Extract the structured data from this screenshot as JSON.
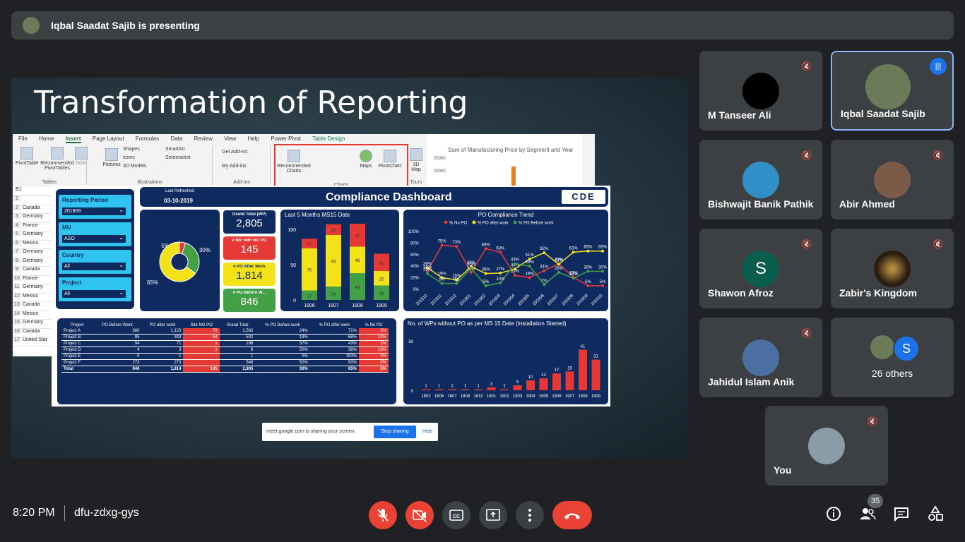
{
  "presenting": "Iqbal Saadat Sajib is presenting",
  "slide": {
    "title": "Transformation of Reporting",
    "ribbon_tabs": [
      "File",
      "Home",
      "Insert",
      "Page Layout",
      "Formulas",
      "Data",
      "Review",
      "View",
      "Help",
      "Power Pivot",
      "Table Design"
    ],
    "ribbon_groups": {
      "tables": "Tables",
      "illustrations": "Illustrations",
      "addins": "Add-ins",
      "charts": "Charts",
      "tours": "Tours"
    },
    "ribbon_tools": {
      "pivot_table": "PivotTable",
      "rec_pivot": "Recommended PivotTables",
      "table": "Table",
      "pictures": "Pictures",
      "shapes": "Shapes",
      "icons": "Icons",
      "models_3d": "3D Models",
      "smartart": "SmartArt",
      "screenshot": "Screenshot",
      "get_addins": "Get Add-ins",
      "my_addins": "My Add-ins",
      "rec_charts": "Recommended Charts",
      "maps": "Maps",
      "pivot_chart": "PivotChart",
      "map_3d": "3D Map"
    },
    "chart_thumb": {
      "title": "Sum of Manufacturing Price by Segment and Year",
      "t1": "25000",
      "t2": "20000"
    },
    "sheet": {
      "cell_ref": "B1",
      "rows": [
        {
          "n": "1",
          "v": ""
        },
        {
          "n": "2",
          "v": "Canada"
        },
        {
          "n": "3",
          "v": "Germany"
        },
        {
          "n": "4",
          "v": "France"
        },
        {
          "n": "5",
          "v": "Germany"
        },
        {
          "n": "6",
          "v": "Mexico"
        },
        {
          "n": "7",
          "v": "Germany"
        },
        {
          "n": "8",
          "v": "Germany"
        },
        {
          "n": "9",
          "v": "Canada"
        },
        {
          "n": "10",
          "v": "France"
        },
        {
          "n": "11",
          "v": "Germany"
        },
        {
          "n": "12",
          "v": "Mexico"
        },
        {
          "n": "13",
          "v": "Canada"
        },
        {
          "n": "14",
          "v": "Mexico"
        },
        {
          "n": "15",
          "v": "Germany"
        },
        {
          "n": "16",
          "v": "Canada"
        },
        {
          "n": "17",
          "v": "United Stat"
        }
      ]
    },
    "share_bar": {
      "text": "meet.google.com is sharing your screen.",
      "stop": "Stop sharing",
      "hide": "Hide"
    }
  },
  "dashboard": {
    "last_refreshed_label": "Last Refreshed",
    "last_refreshed": "03-10-2019",
    "title": "Compliance Dashboard",
    "logo": "CDE",
    "filters": [
      {
        "label": "Reporting Period",
        "value": "201909"
      },
      {
        "label": "MU",
        "value": "ASO"
      },
      {
        "label": "Country",
        "value": "All"
      },
      {
        "label": "Project",
        "value": "All"
      }
    ],
    "kpis": [
      {
        "label": "Grand Total (WP)",
        "value": "2,805",
        "bg": "#0f2a5e",
        "fg": "#ffffff"
      },
      {
        "label": "# WP with NO PO",
        "value": "145",
        "bg": "#e53935",
        "fg": "#ffffff"
      },
      {
        "label": "# PO After Work",
        "value": "1,814",
        "bg": "#f4e218",
        "fg": "#0f2a5e"
      },
      {
        "label": "# PO Before W...",
        "value": "846",
        "bg": "#43a047",
        "fg": "#ffffff"
      }
    ],
    "table": {
      "headers": [
        "Project",
        "PO Before Work",
        "PO after work",
        "Site NO PO",
        "Grand Total",
        "% PO Before work",
        "% PO after work",
        "% No PO"
      ],
      "rows": [
        [
          "Project A",
          "380",
          "1,123",
          "79",
          "1,582",
          "24%",
          "71%",
          "5%"
        ],
        [
          "Project B",
          "95",
          "343",
          "64",
          "502",
          "19%",
          "68%",
          "13%"
        ],
        [
          "Project C",
          "94",
          "71",
          "1",
          "166",
          "57%",
          "43%",
          "1%"
        ],
        [
          "Project D",
          "4",
          "3",
          "1",
          "8",
          "50%",
          "38%",
          "13%"
        ],
        [
          "Project E",
          "0",
          "1",
          "",
          "1",
          "0%",
          "100%",
          "0%"
        ],
        [
          "Project F",
          "273",
          "273",
          "",
          "546",
          "50%",
          "50%",
          "0%"
        ]
      ],
      "total": [
        "Total",
        "846",
        "1,814",
        "145",
        "2,805",
        "30%",
        "65%",
        "5%"
      ]
    }
  },
  "chart_data": [
    {
      "type": "pie",
      "labels": [
        "5%",
        "30%",
        "65%"
      ],
      "values": [
        5,
        30,
        65
      ],
      "colors": [
        "#e53935",
        "#43a047",
        "#f4e218"
      ]
    },
    {
      "type": "bar",
      "title": "Last 5 Months MS15 Date",
      "categories": [
        "1906",
        "1907",
        "1908",
        "1909"
      ],
      "y_ticks": [
        "100",
        "50",
        "0"
      ],
      "ylim": [
        0,
        100
      ],
      "stacked": true,
      "series": [
        {
          "values": [
            17,
            24,
            48,
            26
          ],
          "color": "#43a047"
        },
        {
          "values": [
            76,
            93,
            48,
            26
          ],
          "color": "#f4e218"
        },
        {
          "values": [
            17,
            19,
            41,
            31
          ],
          "color": "#e53935"
        }
      ]
    },
    {
      "type": "line",
      "title": "PO Compliance Trend",
      "x": [
        "201810",
        "201811",
        "201812",
        "201901",
        "201902",
        "201903",
        "201904",
        "201905",
        "201906",
        "201907",
        "201908",
        "201909",
        "201910"
      ],
      "y_ticks": [
        "100%",
        "80%",
        "60%",
        "40%",
        "20%",
        "0%"
      ],
      "ylim": [
        0,
        100
      ],
      "series": [
        {
          "name": "% No PO",
          "color": "#e53935",
          "values": [
            30,
            75,
            73,
            28,
            69,
            63,
            23,
            19,
            31,
            43,
            20,
            5,
            5
          ]
        },
        {
          "name": "% PO after work",
          "color": "#f4e218",
          "values": [
            36,
            19,
            15,
            38,
            26,
            27,
            34,
            51,
            62,
            42,
            63,
            65,
            65
          ]
        },
        {
          "name": "% PO Before work",
          "color": "#43a047",
          "values": [
            26,
            9,
            9,
            35,
            5,
            10,
            43,
            39,
            7,
            28,
            18,
            30,
            30
          ]
        }
      ]
    },
    {
      "type": "bar",
      "title": "No. of WPs without PO as per MS 15 Date (Installation Started)",
      "categories": [
        "1802",
        "1806",
        "1807",
        "1808",
        "1810",
        "1901",
        "1902",
        "1903",
        "1904",
        "1905",
        "1906",
        "1907",
        "1908",
        "1909"
      ],
      "values": [
        1,
        1,
        1,
        1,
        1,
        3,
        1,
        5,
        10,
        12,
        17,
        19,
        41,
        31
      ],
      "y_ticks": [
        "50",
        "0"
      ],
      "ylim": [
        0,
        50
      ],
      "color": "#e53935"
    }
  ],
  "participants": [
    {
      "name": "M Tanseer Ali",
      "avatar": "#000000"
    },
    {
      "name": "Iqbal Saadat Sajib",
      "avatar": "#6b7b5a"
    },
    {
      "name": "Bishwajit Banik Pathik",
      "avatar": "#2f8fc6"
    },
    {
      "name": "Abir Ahmed",
      "avatar": "#7b5a48"
    },
    {
      "name": "Shawon Afroz",
      "initial": "S"
    },
    {
      "name": "Zabir's Kingdom",
      "avatar": "#3b2a16"
    },
    {
      "name": "Jahidul Islam Anik",
      "avatar": "#4a6fa0"
    },
    {
      "name": "You",
      "avatar": "#8a9ca8"
    }
  ],
  "others": {
    "label": "26 others",
    "initial": "S"
  },
  "bottom": {
    "time": "8:20 PM",
    "meeting_code": "dfu-zdxg-gys",
    "people_count": "35"
  },
  "icons": {
    "mic_off": "mic-off-icon",
    "cam_off": "camera-off-icon",
    "captions": "captions-icon",
    "present": "present-icon",
    "more": "more-options-icon",
    "hangup": "hangup-icon",
    "info": "info-icon",
    "people": "people-icon",
    "chat": "chat-icon",
    "activities": "activities-icon"
  }
}
